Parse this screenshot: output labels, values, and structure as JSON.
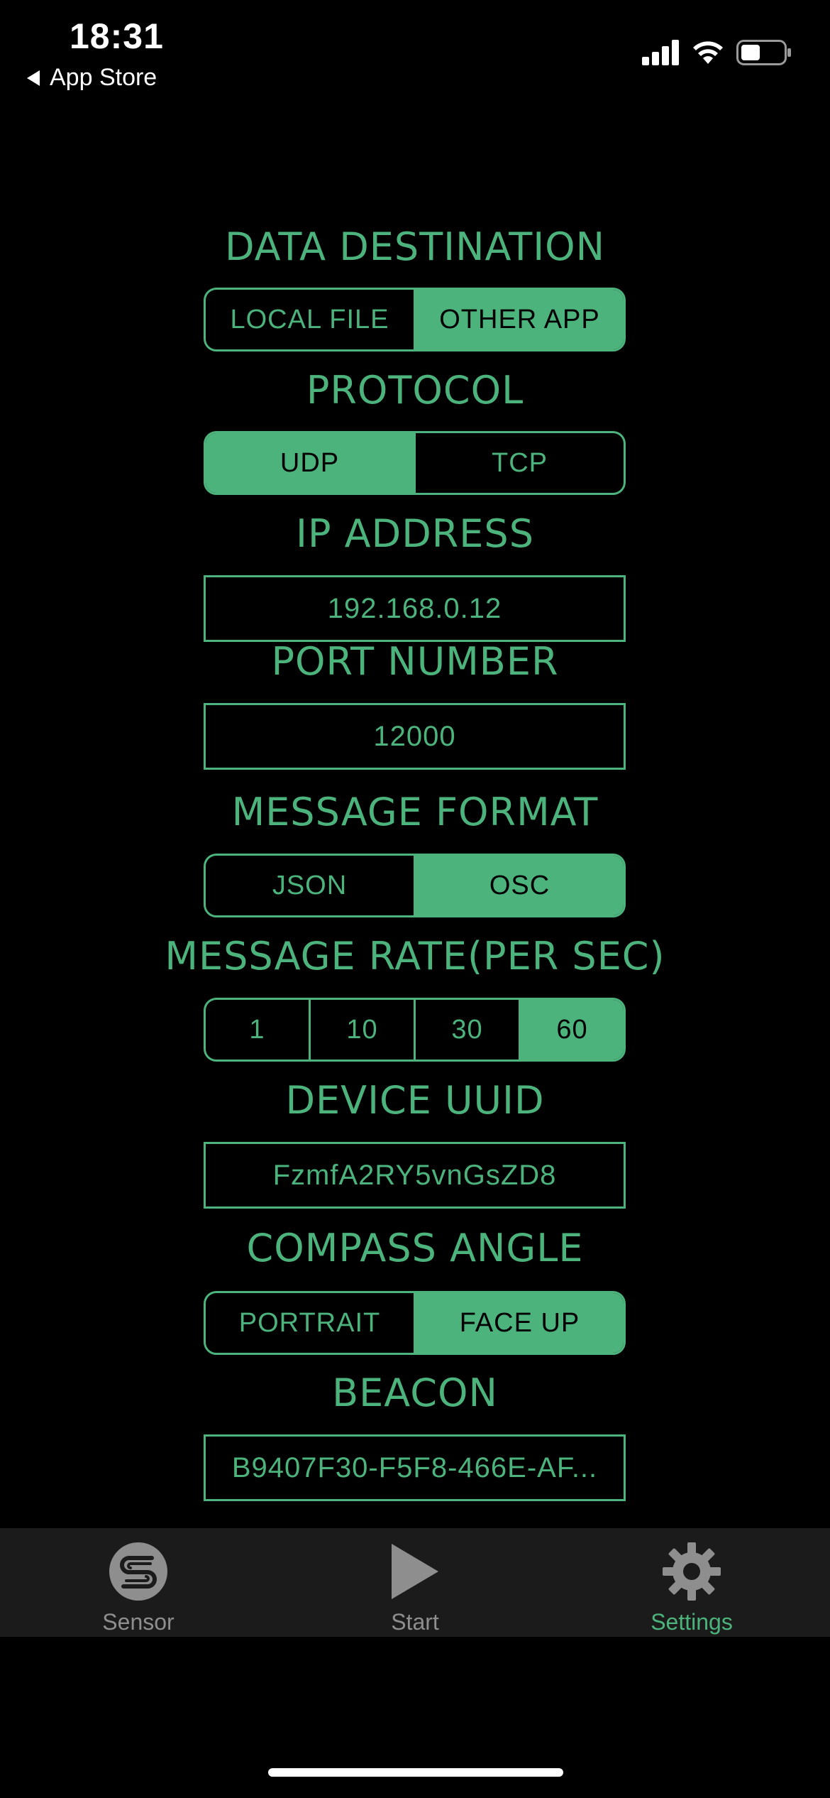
{
  "status_bar": {
    "time": "18:31",
    "back_label": "App Store",
    "icons": [
      "signal-icon",
      "wifi-icon",
      "battery-icon"
    ]
  },
  "settings": {
    "data_destination": {
      "title": "DATA DESTINATION",
      "options": [
        "LOCAL FILE",
        "OTHER APP"
      ],
      "selected": "OTHER APP"
    },
    "protocol": {
      "title": "PROTOCOL",
      "options": [
        "UDP",
        "TCP"
      ],
      "selected": "UDP"
    },
    "ip_address": {
      "title": "IP ADDRESS",
      "value": "192.168.0.12"
    },
    "port_number": {
      "title": "PORT NUMBER",
      "value": "12000"
    },
    "message_format": {
      "title": "MESSAGE FORMAT",
      "options": [
        "JSON",
        "OSC"
      ],
      "selected": "OSC"
    },
    "message_rate": {
      "title": "MESSAGE RATE(PER SEC)",
      "options": [
        "1",
        "10",
        "30",
        "60"
      ],
      "selected": "60"
    },
    "device_uuid": {
      "title": "DEVICE UUID",
      "value": "FzmfA2RY5vnGsZD8"
    },
    "compass_angle": {
      "title": "COMPASS ANGLE",
      "options": [
        "PORTRAIT",
        "FACE UP"
      ],
      "selected": "FACE UP"
    },
    "beacon": {
      "title": "BEACON",
      "value": "B9407F30-F5F8-466E-AF..."
    }
  },
  "tab_bar": {
    "tabs": [
      {
        "label": "Sensor",
        "icon": "sensor-icon"
      },
      {
        "label": "Start",
        "icon": "play-icon"
      },
      {
        "label": "Settings",
        "icon": "gear-icon"
      }
    ],
    "active": "Settings"
  },
  "colors": {
    "accent": "#4cb37c",
    "background": "#000000",
    "tabbar_bg": "#1b1b1b",
    "inactive_tab": "#8e8e8e"
  }
}
